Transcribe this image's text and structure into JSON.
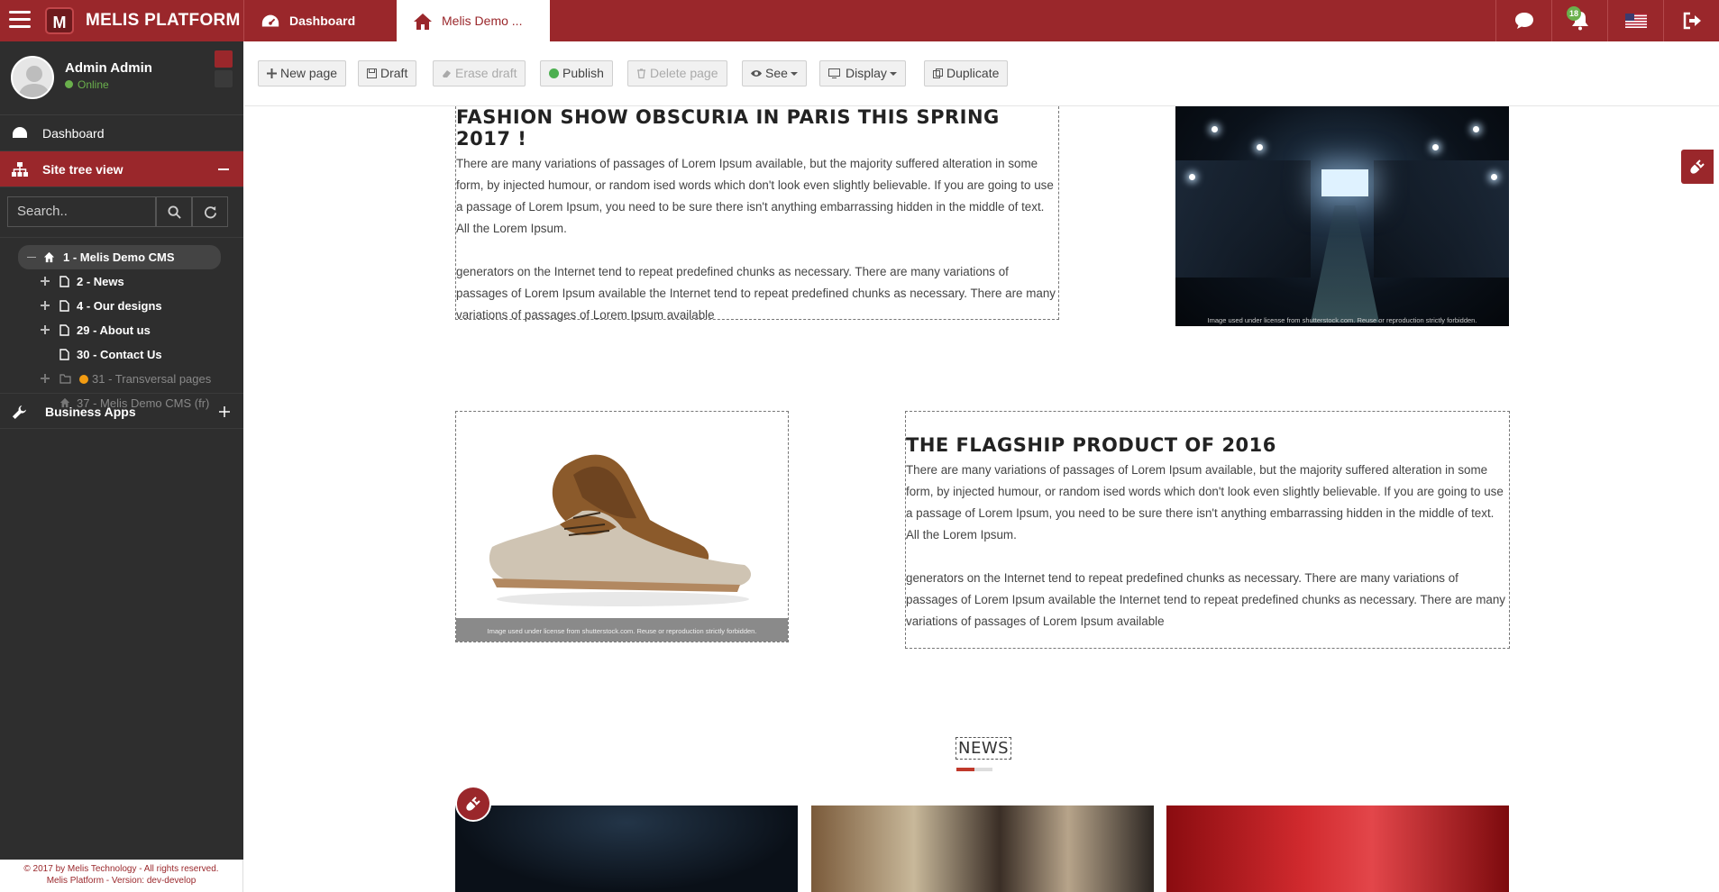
{
  "app": {
    "brand": "MELIS PLATFORM",
    "logo_letter": "M",
    "tabs": [
      {
        "label": "Dashboard",
        "icon": "dashboard-icon"
      },
      {
        "label": "Melis Demo ...",
        "icon": "home-icon"
      }
    ],
    "notifications_count": "18",
    "accent_color": "#9a272b"
  },
  "user": {
    "name": "Admin Admin",
    "status": "Online"
  },
  "sidebar": {
    "dashboard": "Dashboard",
    "site_tree": "Site tree view",
    "search_placeholder": "Search..",
    "tree": {
      "root": "1 - Melis Demo CMS",
      "children": [
        {
          "label": "2 - News",
          "expandable": true
        },
        {
          "label": "4 - Our designs",
          "expandable": true
        },
        {
          "label": "29 - About us",
          "expandable": true
        },
        {
          "label": "30 - Contact Us",
          "expandable": false
        },
        {
          "label": "31 - Transversal pages",
          "expandable": true,
          "status": "unpublished"
        },
        {
          "label": "37 - Melis Demo CMS (fr)",
          "expandable": false
        }
      ]
    },
    "business_apps": "Business Apps",
    "footer_line1": "© 2017 by Melis Technology - All rights reserved.",
    "footer_line2": "Melis Platform - Version: dev-develop"
  },
  "toolbar": {
    "new_page": "New page",
    "draft": "Draft",
    "erase_draft": "Erase draft",
    "publish": "Publish",
    "delete_page": "Delete page",
    "see": "See",
    "display": "Display",
    "duplicate": "Duplicate"
  },
  "content": {
    "section1": {
      "title": "FASHION SHOW OBSCURIA IN PARIS THIS SPRING 2017 !",
      "para1": "There are many variations of passages of Lorem Ipsum available, but the majority suffered alteration in some form, by injected humour, or random ised words which don't look even slightly believable. If you are going to use a passage of Lorem Ipsum, you need to be sure there isn't anything embarrassing hidden in the middle of text. All the Lorem Ipsum.",
      "para2": "generators on the Internet tend to repeat predefined chunks as necessary. There are many variations of passages of Lorem Ipsum available the Internet tend to repeat predefined chunks as necessary. There are many variations of passages of Lorem Ipsum available",
      "image_credit": "Image used under license from shutterstock.com. Reuse or reproduction strictly forbidden."
    },
    "section2": {
      "title": "THE FLAGSHIP PRODUCT OF 2016",
      "para1": "There are many variations of passages of Lorem Ipsum available, but the majority suffered alteration in some form, by injected humour, or random ised words which don't look even slightly believable. If you are going to use a passage of Lorem Ipsum, you need to be sure there isn't anything embarrassing hidden in the middle of text. All the Lorem Ipsum.",
      "para2": "generators on the Internet tend to repeat predefined chunks as necessary. There are many variations of passages of Lorem Ipsum available the Internet tend to repeat predefined chunks as necessary. There are many variations of passages of Lorem Ipsum available",
      "image_credit": "Image used under license from shutterstock.com. Reuse or reproduction strictly forbidden."
    },
    "news_title": "NEWS"
  }
}
